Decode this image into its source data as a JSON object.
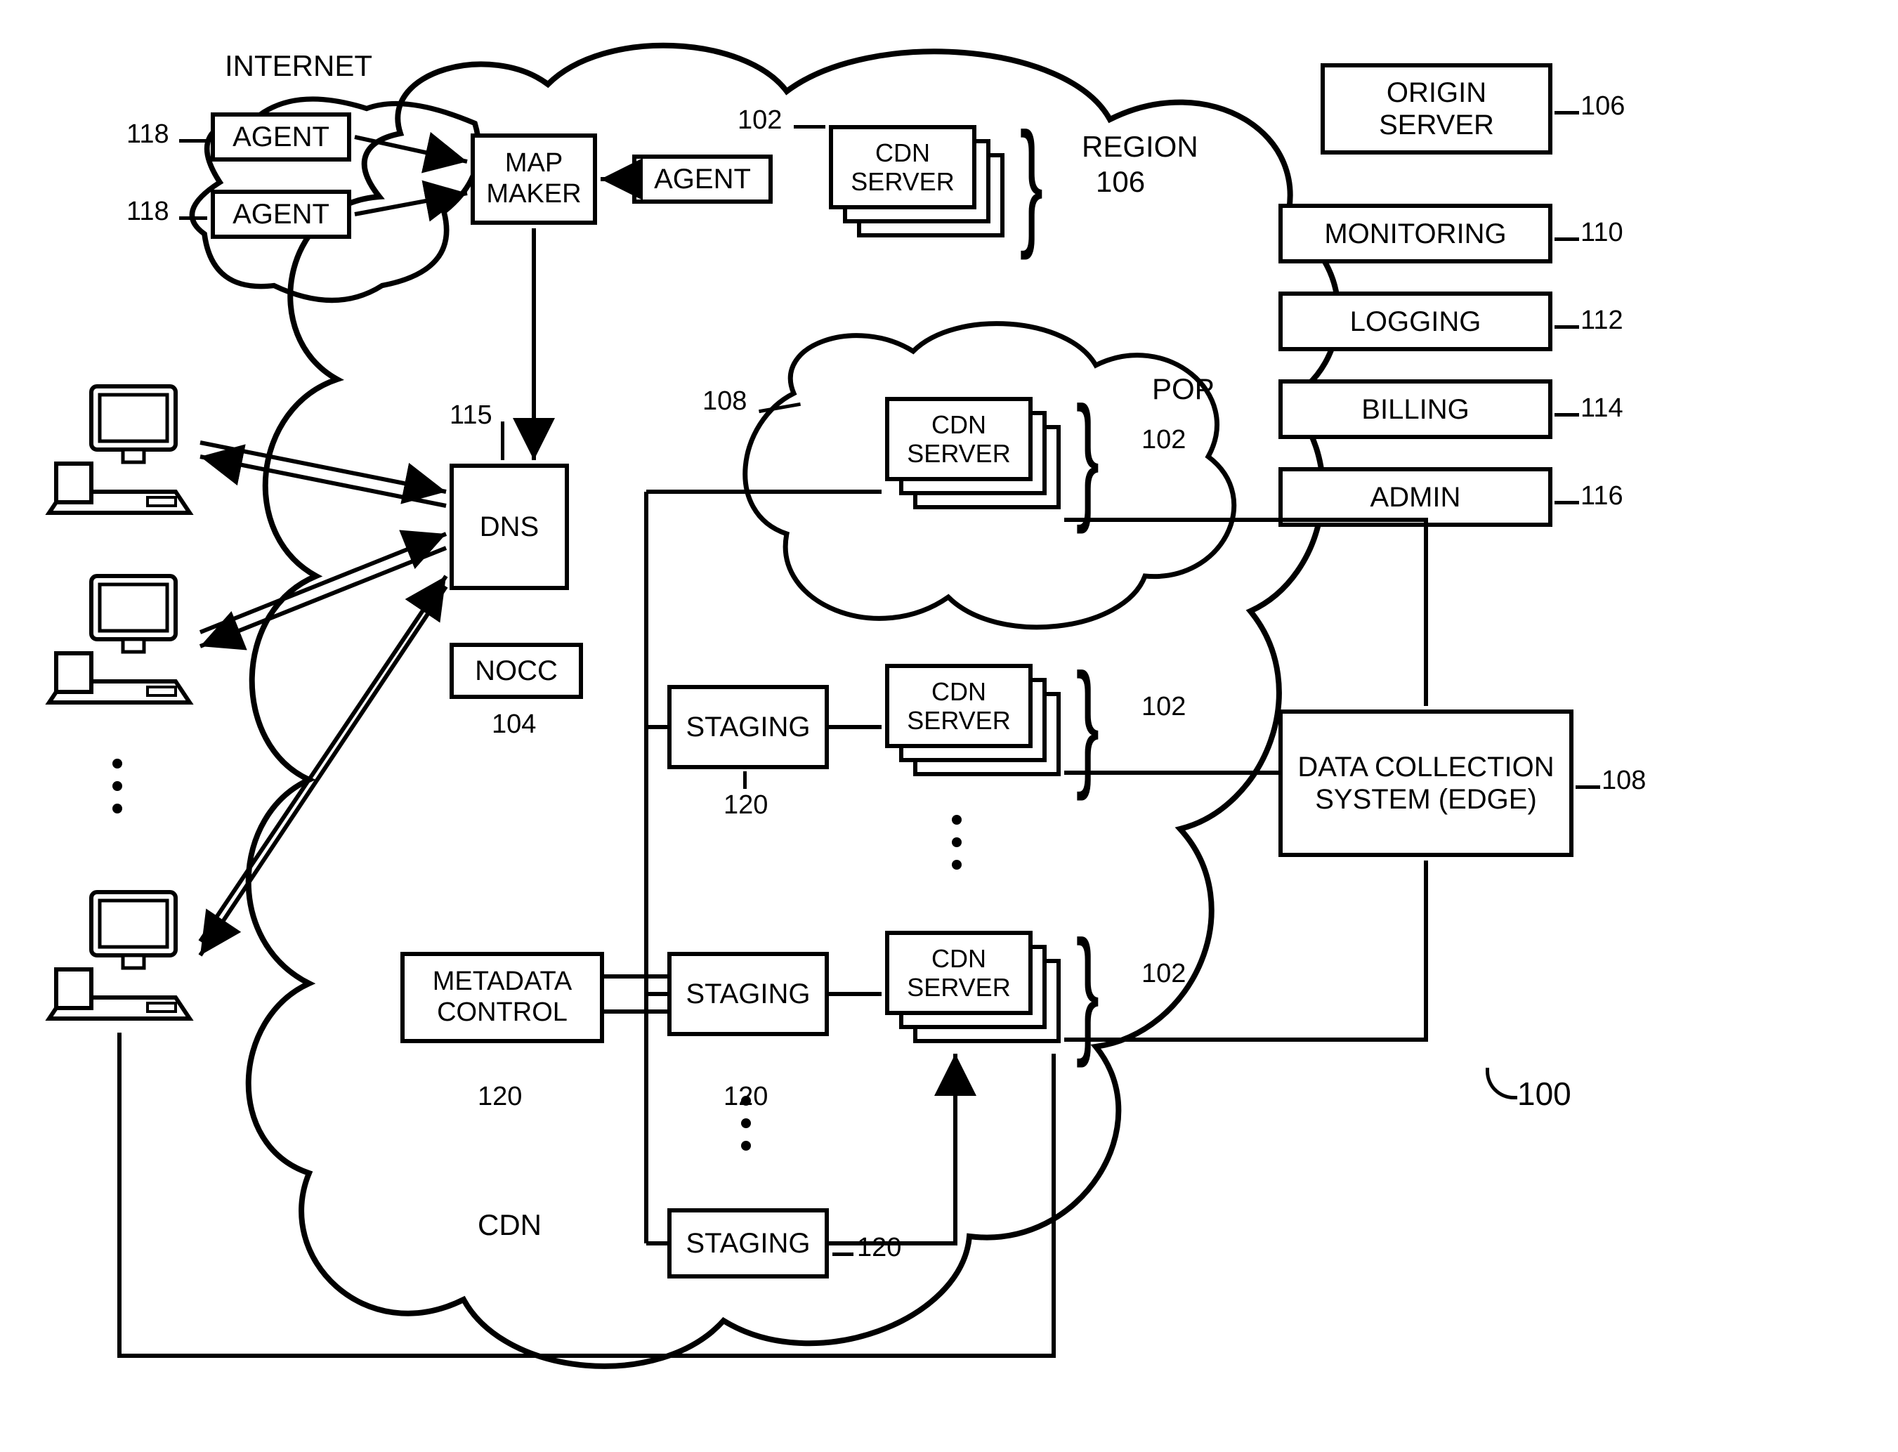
{
  "clouds": {
    "internet": "INTERNET",
    "cdn": "CDN",
    "pop": "POP"
  },
  "boxes": {
    "agent1": "AGENT",
    "agent2": "AGENT",
    "agent3": "AGENT",
    "mapmaker": "MAP\nMAKER",
    "cdnserver": "CDN\nSERVER",
    "dns": "DNS",
    "nocc": "NOCC",
    "staging": "STAGING",
    "metadata": "METADATA\nCONTROL",
    "origin": "ORIGIN\nSERVER",
    "monitoring": "MONITORING",
    "logging": "LOGGING",
    "billing": "BILLING",
    "admin": "ADMIN",
    "dcs": "DATA\nCOLLECTION\nSYSTEM (EDGE)",
    "region": "REGION"
  },
  "refs": {
    "r100": "100",
    "r102": "102",
    "r104": "104",
    "r106": "106",
    "r108": "108",
    "r110": "110",
    "r112": "112",
    "r114": "114",
    "r115": "115",
    "r116": "116",
    "r118": "118",
    "r120": "120"
  }
}
